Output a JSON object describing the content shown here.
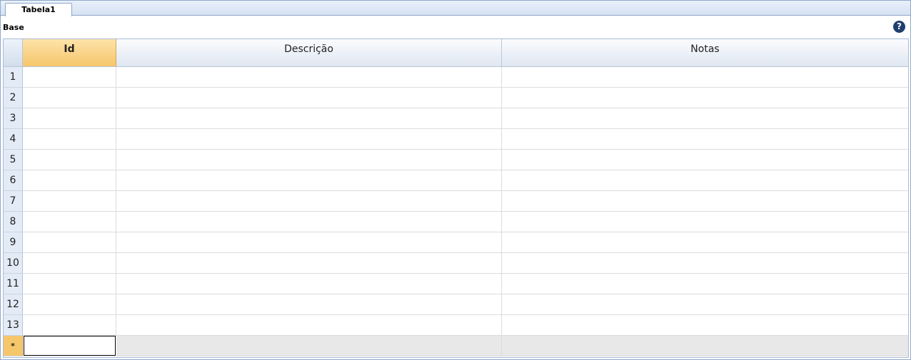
{
  "tab": {
    "label": "Tabela1"
  },
  "form": {
    "title": "Base",
    "help_icon": "?"
  },
  "grid": {
    "columns": [
      "Id",
      "Descrição",
      "Notas"
    ],
    "rows": [
      "1",
      "2",
      "3",
      "4",
      "5",
      "6",
      "7",
      "8",
      "9",
      "10",
      "11",
      "12",
      "13"
    ],
    "new_row_marker": "*"
  },
  "colors": {
    "header_selected": "#f6c66b",
    "header": "#dfe7f2",
    "frame_border": "#8fa8c8",
    "new_row_bg": "#e8e8e8"
  }
}
